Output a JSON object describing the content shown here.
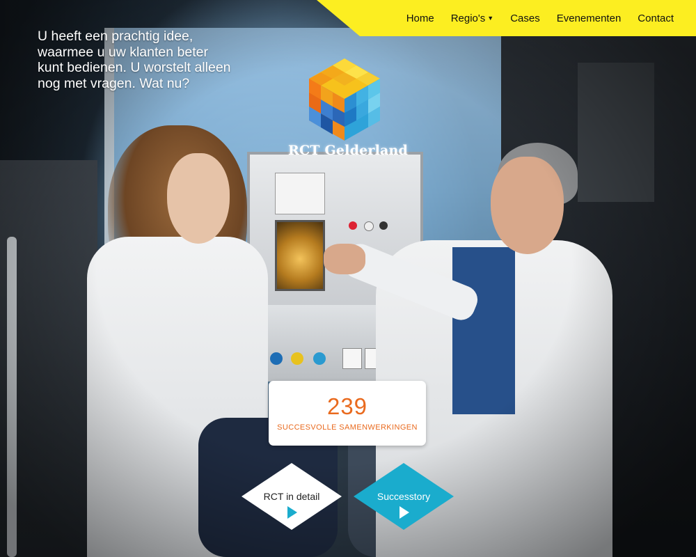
{
  "nav": {
    "items": [
      {
        "label": "Home"
      },
      {
        "label": "Regio's",
        "dropdown_icon": "caret-down-icon"
      },
      {
        "label": "Cases"
      },
      {
        "label": "Evenementen"
      },
      {
        "label": "Contact"
      }
    ],
    "bar_color": "#fcee21"
  },
  "hero": {
    "lines": [
      "U heeft een prachtig idee,",
      "waarmee u uw klanten beter",
      "kunt bedienen. U worstelt alleen",
      "nog met vragen. Wat nu?"
    ]
  },
  "brand": {
    "name": "RCT Gelderland",
    "logo_icon": "rct-cube-logo-icon"
  },
  "stat": {
    "value": "239",
    "label": "SUCCESVOLLE SAMENWERKINGEN",
    "color": "#e96a1e"
  },
  "buttons": {
    "detail": {
      "label": "RCT in detail",
      "icon": "play-icon"
    },
    "story": {
      "label": "Successtory",
      "icon": "play-icon",
      "color": "#1aaccd"
    }
  }
}
